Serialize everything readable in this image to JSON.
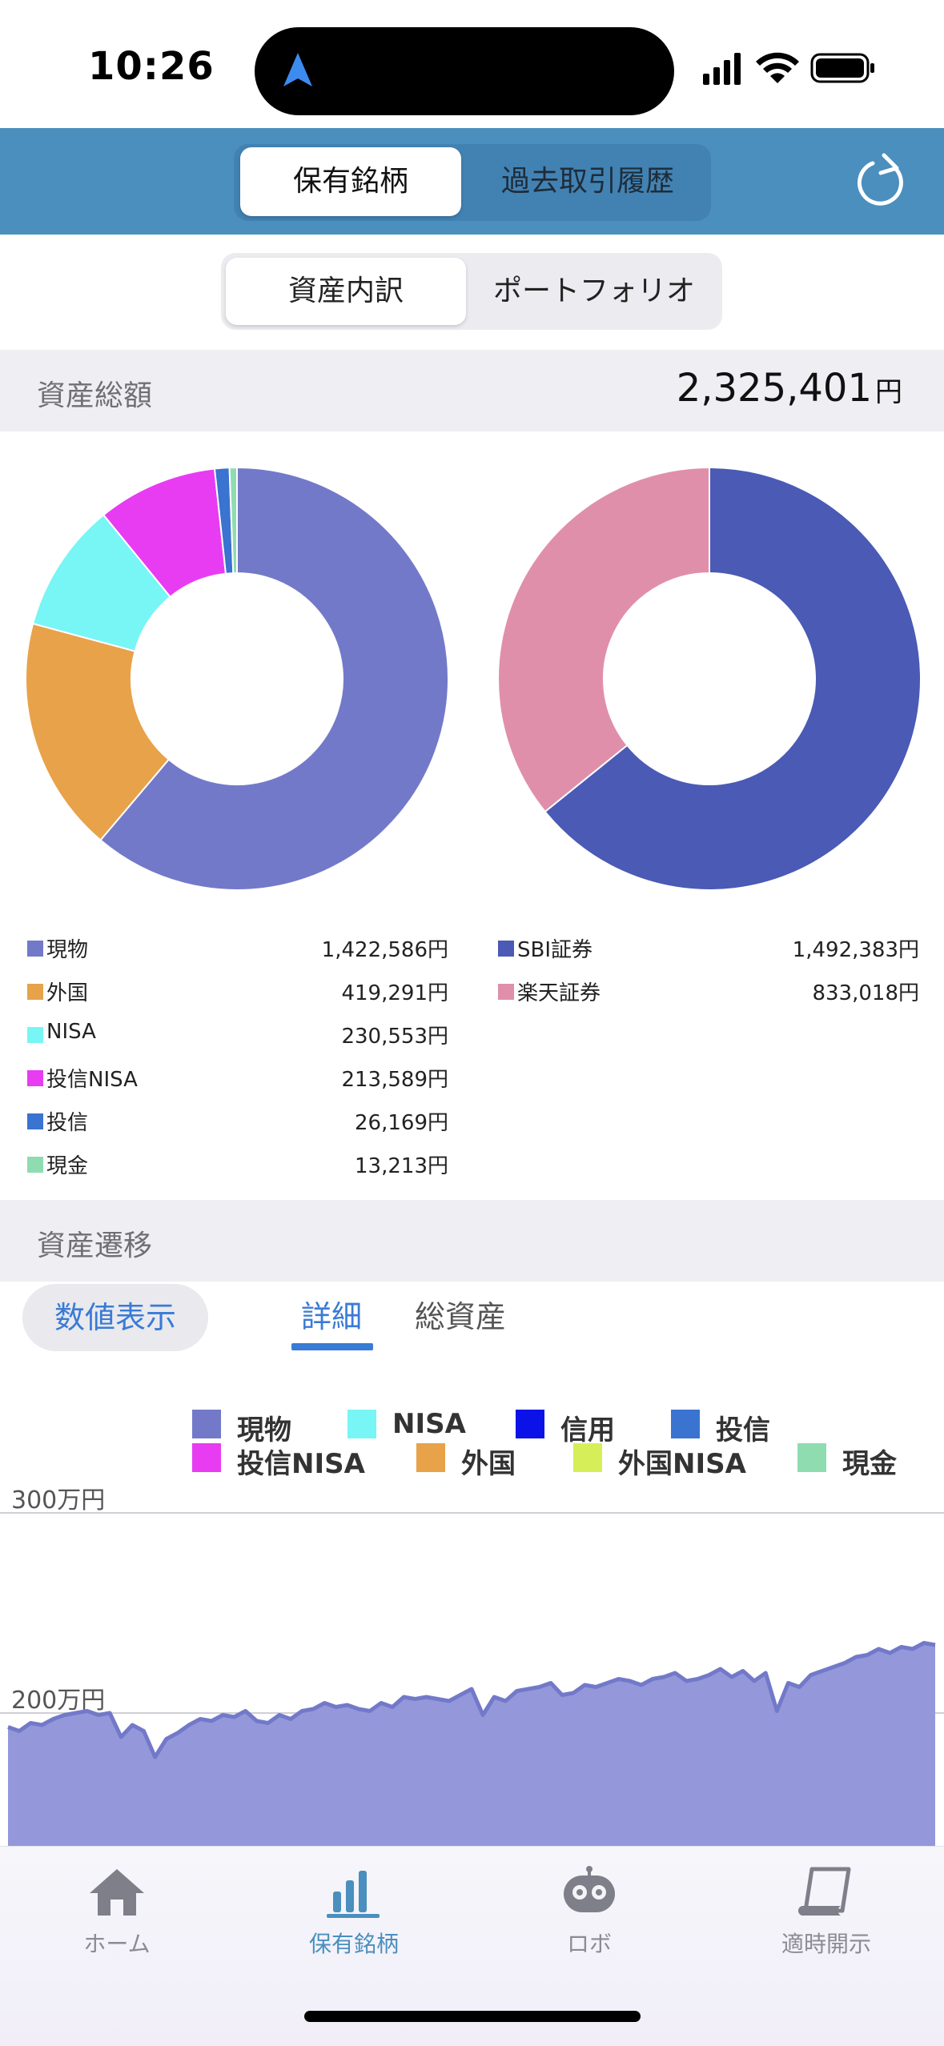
{
  "status_bar": {
    "time": "10:26"
  },
  "header": {
    "tabs": [
      {
        "label": "保有銘柄",
        "active": true
      },
      {
        "label": "過去取引履歴",
        "active": false
      }
    ],
    "refresh_icon": "refresh-icon"
  },
  "sub_tabs": [
    {
      "label": "資産内訳",
      "active": true
    },
    {
      "label": "ポートフォリオ",
      "active": false
    }
  ],
  "total": {
    "label": "資産総額",
    "value": "2,325,401",
    "unit": "円"
  },
  "breakdown_by_type": [
    {
      "name": "現物",
      "value": "1,422,586円",
      "color": "#7379c9"
    },
    {
      "name": "外国",
      "value": "419,291円",
      "color": "#e8a24a"
    },
    {
      "name": "NISA",
      "value": "230,553円",
      "color": "#78f5f5"
    },
    {
      "name": "投信NISA",
      "value": "213,589円",
      "color": "#e83cf2"
    },
    {
      "name": "投信",
      "value": "26,169円",
      "color": "#3a73d0"
    },
    {
      "name": "現金",
      "value": "13,213円",
      "color": "#8fdcb0"
    }
  ],
  "breakdown_by_broker": [
    {
      "name": "SBI証券",
      "value": "1,492,383円",
      "color": "#4a5ab5"
    },
    {
      "name": "楽天証券",
      "value": "833,018円",
      "color": "#e08faa"
    }
  ],
  "trend": {
    "label": "資産遷移",
    "toggle_label": "数値表示",
    "tabs": [
      {
        "label": "詳細",
        "active": true
      },
      {
        "label": "総資産",
        "active": false
      }
    ]
  },
  "chart_data": {
    "type": "area",
    "legend": [
      {
        "name": "現物",
        "color": "#7379c9"
      },
      {
        "name": "NISA",
        "color": "#78f5f5"
      },
      {
        "name": "信用",
        "color": "#0a12e8"
      },
      {
        "name": "投信",
        "color": "#3a73d0"
      },
      {
        "name": "投信NISA",
        "color": "#e83cf2"
      },
      {
        "name": "外国",
        "color": "#e8a24a"
      },
      {
        "name": "外国NISA",
        "color": "#d6ef58"
      },
      {
        "name": "現金",
        "color": "#8fdcb0"
      }
    ],
    "y_ticks": [
      "300万円",
      "200万円"
    ],
    "y_tick_values": [
      3000000,
      2000000
    ],
    "ylabel_unit": "万円",
    "series": [
      {
        "name": "現物",
        "values": [
          1930000,
          1910000,
          1950000,
          1940000,
          1970000,
          1990000,
          2000000,
          2010000,
          1990000,
          2000000,
          1880000,
          1940000,
          1910000,
          1780000,
          1870000,
          1900000,
          1940000,
          1970000,
          1960000,
          1990000,
          1980000,
          2010000,
          1960000,
          1950000,
          1990000,
          1970000,
          2010000,
          2020000,
          2050000,
          2030000,
          2040000,
          2020000,
          2010000,
          2050000,
          2030000,
          2080000,
          2070000,
          2080000,
          2070000,
          2060000,
          2090000,
          2120000,
          1990000,
          2080000,
          2060000,
          2110000,
          2120000,
          2130000,
          2150000,
          2090000,
          2100000,
          2140000,
          2130000,
          2150000,
          2170000,
          2160000,
          2140000,
          2170000,
          2180000,
          2200000,
          2160000,
          2170000,
          2190000,
          2220000,
          2180000,
          2210000,
          2160000,
          2200000,
          2010000,
          2150000,
          2130000,
          2190000,
          2210000,
          2230000,
          2250000,
          2280000,
          2290000,
          2320000,
          2300000,
          2330000,
          2320000,
          2350000,
          2340000
        ]
      }
    ]
  },
  "bottom_nav": [
    {
      "label": "ホーム",
      "icon": "home-icon",
      "active": false
    },
    {
      "label": "保有銘柄",
      "icon": "bar-chart-icon",
      "active": true
    },
    {
      "label": "ロボ",
      "icon": "robot-icon",
      "active": false
    },
    {
      "label": "適時開示",
      "icon": "document-icon",
      "active": false
    }
  ]
}
